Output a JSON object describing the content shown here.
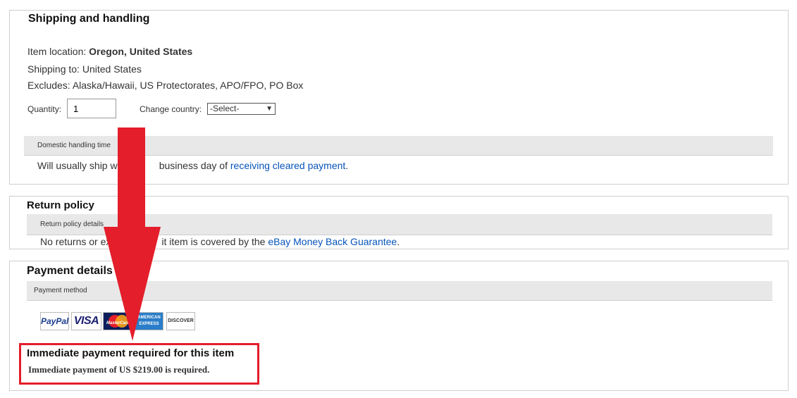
{
  "shipping": {
    "title": "Shipping and handling",
    "item_location_label": "Item location:",
    "item_location_value": "Oregon, United States",
    "shipping_to": "Shipping to: United States",
    "excludes": "Excludes: Alaska/Hawaii, US Protectorates, APO/FPO, PO Box",
    "quantity_label": "Quantity:",
    "quantity_value": "1",
    "change_country_label": "Change country:",
    "country_selected": "-Select-",
    "handling_header": "Domestic handling time",
    "handling_text_start": "Will usually ship wi",
    "handling_text_mid": "business day of ",
    "handling_link": "receiving cleared payment",
    "handling_text_end": "."
  },
  "returns": {
    "title": "Return policy",
    "details_header": "Return policy details",
    "text_start": "No returns or ex",
    "text_mid": "it item is covered by the ",
    "link": "eBay Money Back Guarantee",
    "text_end": "."
  },
  "payment": {
    "title": "Payment details",
    "method_header": "Payment method",
    "cards": [
      "PayPal",
      "VISA",
      "MasterCard",
      "AMERICAN EXPRESS",
      "DISCOVER"
    ],
    "immediate_title": "Immediate payment required for this item",
    "immediate_text": "Immediate payment of US $219.00 is required."
  },
  "colors": {
    "annotation_red": "#e41e2b",
    "link_blue": "#0654ba"
  }
}
